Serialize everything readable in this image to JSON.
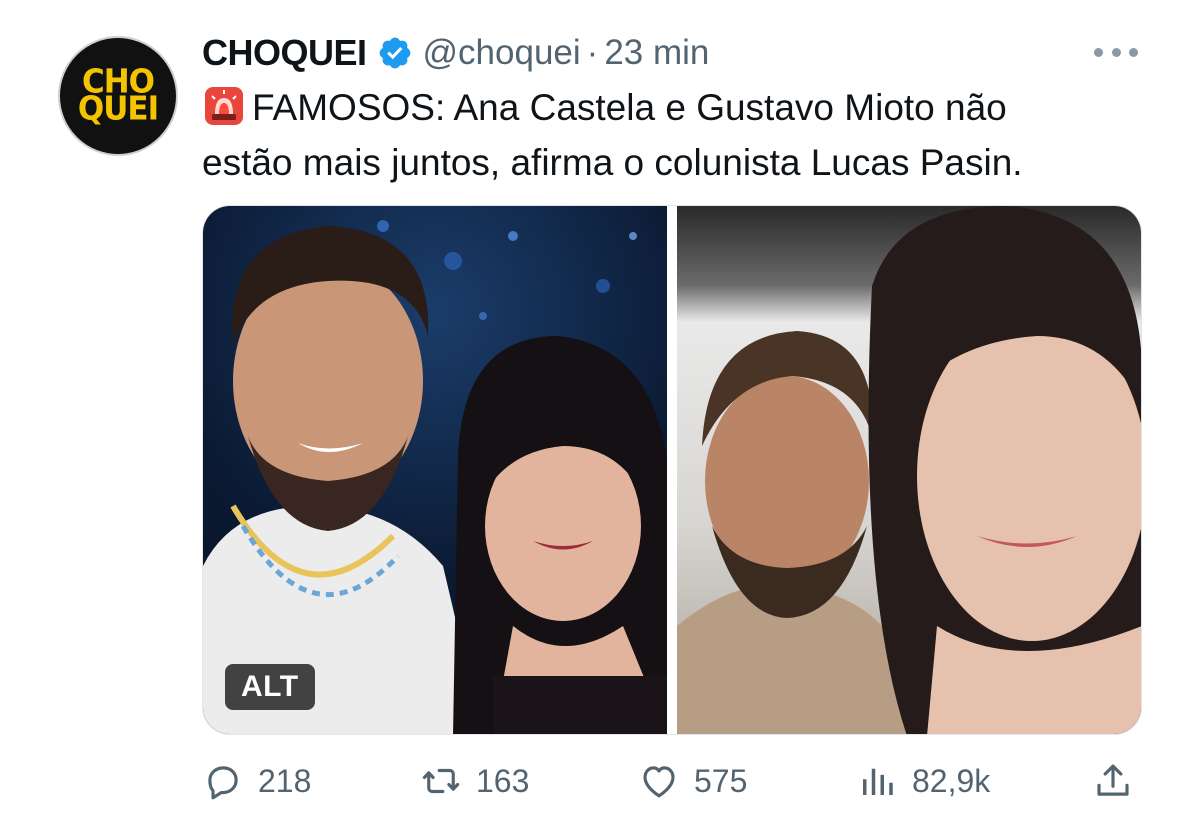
{
  "author": {
    "display_name": "CHOQUEI",
    "handle": "@choquei",
    "separator": "·",
    "time": "23 min",
    "avatar_text": [
      "CHO",
      "QUEI"
    ],
    "verified": true
  },
  "tweet": {
    "text_line1": "FAMOSOS: Ana Castela e Gustavo Mioto não",
    "text_line2": "estão mais juntos, afirma o colunista Lucas Pasin.",
    "emoji_icon": "police-siren-icon"
  },
  "media": {
    "alt_label": "ALT",
    "photo_count": 2
  },
  "actions": {
    "replies": "218",
    "retweets": "163",
    "likes": "575",
    "views": "82,9k"
  },
  "colors": {
    "text": "#0f1419",
    "secondary": "#536471",
    "verified": "#1d9bf0",
    "logo_yellow": "#f5c400"
  }
}
